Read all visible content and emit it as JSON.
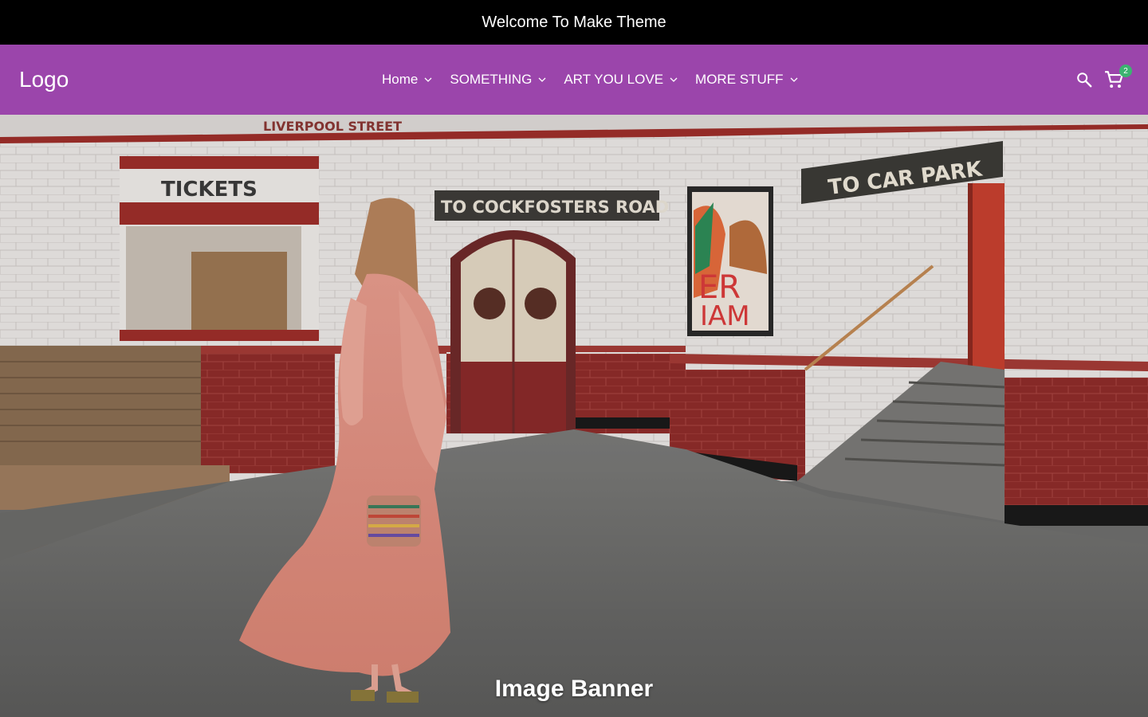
{
  "announcement": {
    "text": "Welcome To Make Theme"
  },
  "header": {
    "logo": "Logo",
    "nav": [
      {
        "label": "Home"
      },
      {
        "label": "SOMETHING"
      },
      {
        "label": "ART YOU LOVE"
      },
      {
        "label": "MORE STUFF"
      }
    ],
    "cart_count": "2",
    "icons": {
      "search": "search-icon",
      "cart": "cart-icon",
      "chevron": "chevron-down-icon"
    },
    "colors": {
      "header_bg": "#9b45ab",
      "announcement_bg": "#000000",
      "cart_badge": "#3cb371"
    }
  },
  "banner": {
    "title": "Image Banner",
    "signs": {
      "station": "LIVERPOOL STREET",
      "tickets": "TICKETS",
      "road": "TO COCKFOSTERS ROAD",
      "car_park": "TO CAR PARK"
    }
  }
}
